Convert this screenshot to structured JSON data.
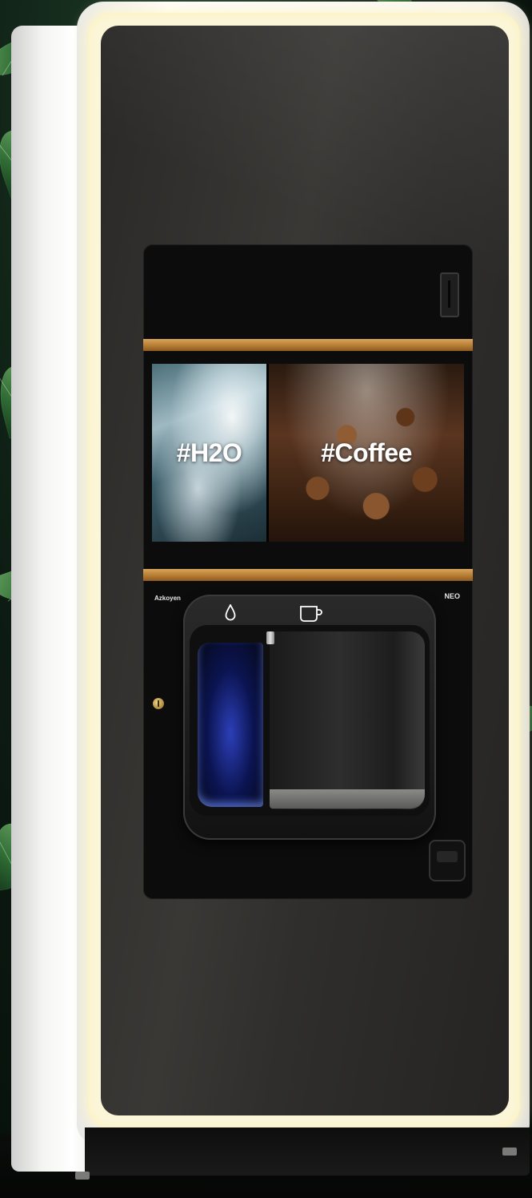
{
  "screen": {
    "tiles": [
      {
        "label": "#H2O"
      },
      {
        "label": "#Coffee"
      }
    ]
  },
  "branding": {
    "left": "Azkoyen",
    "right": "NEO"
  },
  "icons": {
    "water": "water-drop-icon",
    "cup": "cup-icon"
  },
  "colors": {
    "trim": "#c08a40",
    "glow": "#fbf6d8",
    "door": "#2f2e2c",
    "water_light": "#2c3fb8"
  }
}
